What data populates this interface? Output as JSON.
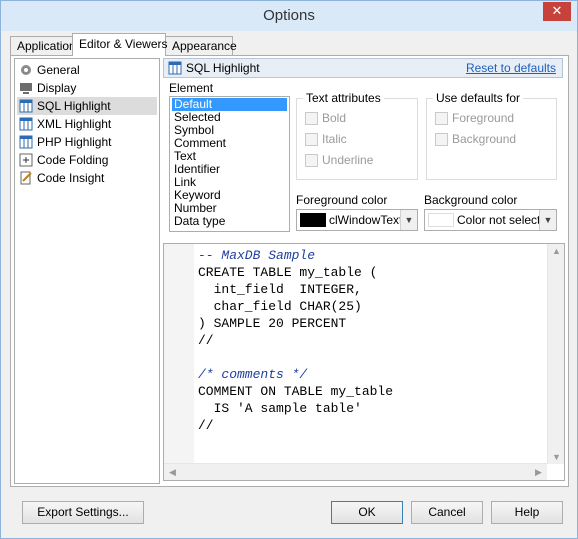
{
  "window": {
    "title": "Options",
    "close_glyph": "✕"
  },
  "tabs": [
    {
      "label": "Application",
      "accel": "A",
      "active": false
    },
    {
      "label": "Editor & Viewers",
      "accel": "E",
      "active": true
    },
    {
      "label": "Appearance",
      "accel": "p",
      "active": false
    }
  ],
  "sidebar": {
    "items": [
      {
        "label": "General",
        "icon": "gear-icon",
        "selected": false
      },
      {
        "label": "Display",
        "icon": "display-icon",
        "selected": false
      },
      {
        "label": "SQL Highlight",
        "icon": "grid-icon",
        "selected": true
      },
      {
        "label": "XML Highlight",
        "icon": "grid-icon",
        "selected": false
      },
      {
        "label": "PHP Highlight",
        "icon": "grid-icon",
        "selected": false
      },
      {
        "label": "Code Folding",
        "icon": "folding-icon",
        "selected": false
      },
      {
        "label": "Code Insight",
        "icon": "pencil-icon",
        "selected": false
      }
    ]
  },
  "panel": {
    "title": "SQL Highlight",
    "reset_label": "Reset to defaults",
    "element_label": "Element",
    "elements": [
      "Default",
      "Selected",
      "Symbol",
      "Comment",
      "Text",
      "Identifier",
      "Link",
      "Keyword",
      "Number",
      "Data type"
    ],
    "selected_element": "Default",
    "text_attributes": {
      "title": "Text attributes",
      "options": [
        {
          "label": "Bold",
          "checked": false,
          "enabled": false
        },
        {
          "label": "Italic",
          "checked": false,
          "enabled": false
        },
        {
          "label": "Underline",
          "checked": false,
          "enabled": false
        }
      ]
    },
    "use_defaults": {
      "title": "Use defaults for",
      "options": [
        {
          "label": "Foreground",
          "checked": false,
          "enabled": false
        },
        {
          "label": "Background",
          "checked": false,
          "enabled": false
        }
      ]
    },
    "foreground": {
      "label": "Foreground color",
      "value": "clWindowText",
      "swatch_color": "#000000"
    },
    "background": {
      "label": "Background color",
      "value": "Color not selected",
      "swatch_color": "#ffffff"
    }
  },
  "preview": {
    "lines": [
      {
        "text": "-- MaxDB Sample",
        "style": "comment"
      },
      {
        "text": "CREATE TABLE my_table (",
        "style": "normal"
      },
      {
        "text": "  int_field  INTEGER,",
        "style": "normal"
      },
      {
        "text": "  char_field CHAR(25)",
        "style": "normal"
      },
      {
        "text": ") SAMPLE 20 PERCENT",
        "style": "normal"
      },
      {
        "text": "//",
        "style": "normal"
      },
      {
        "text": "",
        "style": "normal"
      },
      {
        "text": "/* comments */",
        "style": "comment"
      },
      {
        "text": "COMMENT ON TABLE my_table",
        "style": "normal"
      },
      {
        "text": "  IS 'A sample table'",
        "style": "normal"
      },
      {
        "text": "//",
        "style": "normal"
      }
    ]
  },
  "buttons": {
    "export": "Export Settings...",
    "ok": "OK",
    "cancel": "Cancel",
    "help": "Help"
  },
  "colors": {
    "selection": "#3399ff",
    "link": "#1e5fbf",
    "comment": "#1f3fa1",
    "close": "#c7423a"
  }
}
